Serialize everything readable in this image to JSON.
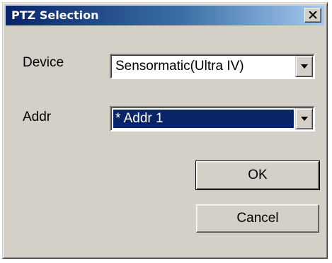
{
  "window": {
    "title": "PTZ Selection",
    "close_label": "×"
  },
  "form": {
    "device_label": "Device",
    "device_value": "Sensormatic(Ultra IV)",
    "addr_label": "Addr",
    "addr_value": "* Addr 1"
  },
  "buttons": {
    "ok_label": "OK",
    "cancel_label": "Cancel"
  },
  "colors": {
    "titlebar_start": "#0a246a",
    "titlebar_end": "#a6caf0",
    "selection": "#0a246a",
    "face": "#d4d0c8"
  },
  "icons": {
    "close": "close-icon",
    "dropdown": "chevron-down-icon"
  }
}
